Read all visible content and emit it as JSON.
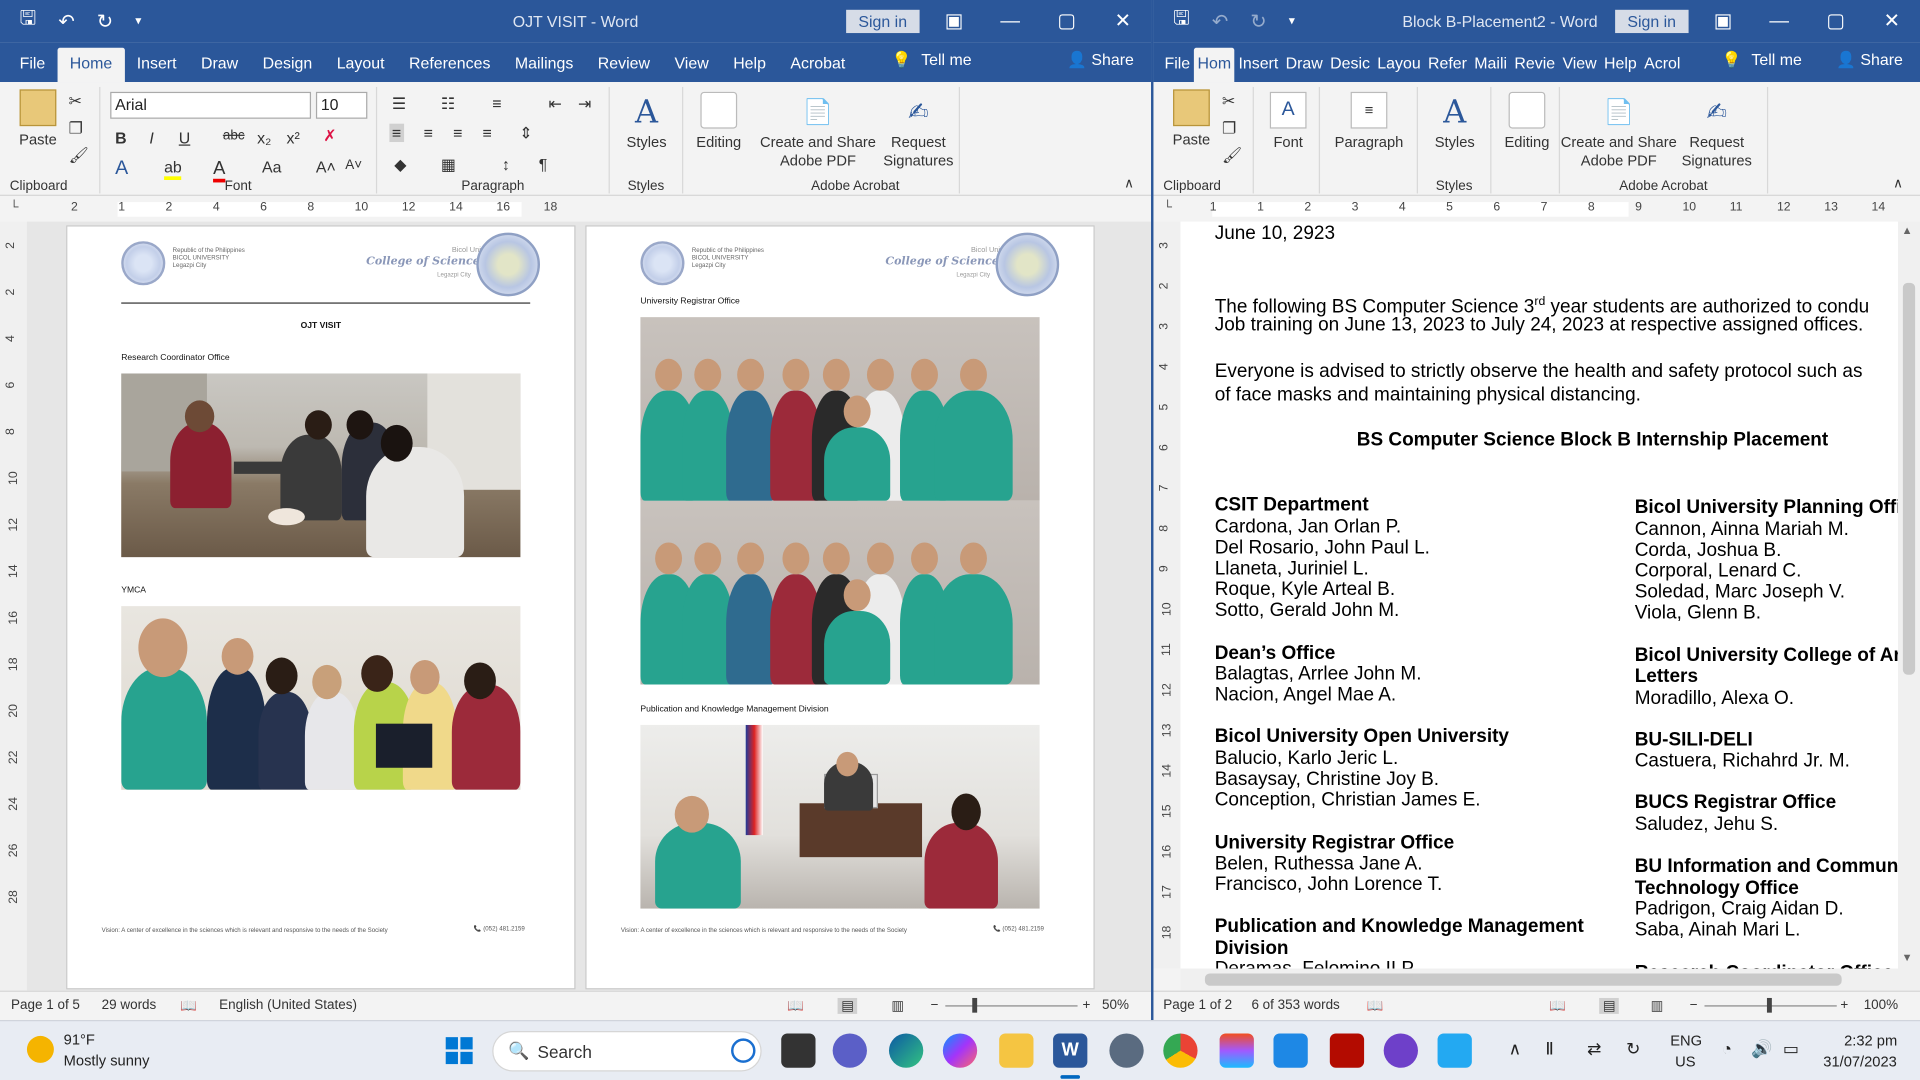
{
  "left_window": {
    "title": "OJT VISIT  -  Word",
    "signin": "Sign in",
    "tabs": [
      "File",
      "Home",
      "Insert",
      "Draw",
      "Design",
      "Layout",
      "References",
      "Mailings",
      "Review",
      "View",
      "Help",
      "Acrobat"
    ],
    "active_tab": "Home",
    "tell_me": "Tell me",
    "share": "Share",
    "font_name": "Arial",
    "font_size": "10",
    "groups": {
      "clipboard": "Clipboard",
      "font": "Font",
      "paragraph": "Paragraph",
      "styles": "Styles",
      "adobe": "Adobe Acrobat"
    },
    "buttons": {
      "paste": "Paste",
      "styles": "Styles",
      "editing": "Editing",
      "create_share_1": "Create and Share",
      "create_share_2": "Adobe PDF",
      "request_1": "Request",
      "request_2": "Signatures"
    },
    "ruler": [
      "2",
      "1",
      "2",
      "4",
      "6",
      "8",
      "10",
      "12",
      "14",
      "16",
      "18"
    ],
    "vruler": [
      "2",
      "2",
      "4",
      "6",
      "8",
      "10",
      "12",
      "14",
      "16",
      "18",
      "20",
      "22",
      "24",
      "26",
      "28"
    ],
    "page1": {
      "republic": "Republic of the Philippines",
      "university": "BICOL UNIVERSITY",
      "city": "Legazpi City",
      "bu": "Bicol University",
      "college": "College of Science",
      "college_city": "Legazpi City",
      "doc_title": "OJT VISIT",
      "caption1": "Research Coordinator Office",
      "caption2": "YMCA",
      "vision": "Vision: A center of excellence in the sciences which is relevant and responsive to the needs of the Society",
      "phone": "(052) 481.2159"
    },
    "page2": {
      "caption1": "University Registrar Office",
      "caption2": "Publication and Knowledge Management Division"
    },
    "status": {
      "page": "Page 1 of 5",
      "words": "29 words",
      "language": "English (United States)",
      "zoom": "50%"
    }
  },
  "right_window": {
    "title": "Block B-Placement2  -  Word",
    "signin": "Sign in",
    "tabs": [
      "File",
      "Hom",
      "Insert",
      "Draw",
      "Desic",
      "Layou",
      "Refer",
      "Maili",
      "Revie",
      "View",
      "Help",
      "Acrol"
    ],
    "active_tab": "Hom",
    "tell_me": "Tell me",
    "share": "Share",
    "groups": {
      "clipboard": "Clipboard",
      "styles": "Styles",
      "adobe": "Adobe Acrobat"
    },
    "buttons": {
      "paste": "Paste",
      "font": "Font",
      "paragraph": "Paragraph",
      "styles": "Styles",
      "editing": "Editing",
      "create_share_1": "Create and Share",
      "create_share_2": "Adobe PDF",
      "request_1": "Request",
      "request_2": "Signatures"
    },
    "ruler": [
      "1",
      "1",
      "2",
      "3",
      "4",
      "5",
      "6",
      "7",
      "8",
      "9",
      "10",
      "11",
      "12",
      "13",
      "14"
    ],
    "vruler": [
      "3",
      "2",
      "3",
      "4",
      "5",
      "6",
      "7",
      "8",
      "9",
      "10",
      "11",
      "12",
      "13",
      "14",
      "15",
      "16",
      "17",
      "18"
    ],
    "doc": {
      "date": "June 10, 2923",
      "para1_a": "The following BS Computer Science 3",
      "para1_sup": "rd",
      "para1_b": " year students are authorized to condu",
      "para1_line2": "Job training on June 13, 2023 to July 24, 2023 at respective assigned offices.",
      "para2_line1": "Everyone is advised to strictly observe the health and safety protocol such as",
      "para2_line2": "of face masks and maintaining physical distancing.",
      "heading": "BS Computer Science Block B Internship Placement",
      "left_col": [
        {
          "office": [
            "CSIT Department"
          ],
          "names": [
            "Cardona, Jan Orlan P.",
            "Del Rosario, John Paul L.",
            "Llaneta, Juriniel L.",
            "Roque, Kyle Arteal B.",
            "Sotto, Gerald John M."
          ]
        },
        {
          "office": [
            "Dean’s Office"
          ],
          "names": [
            "Balagtas, Arrlee John M.",
            "Nacion, Angel Mae A."
          ]
        },
        {
          "office": [
            "Bicol University Open University"
          ],
          "names": [
            "Balucio, Karlo Jeric L.",
            "Basaysay, Christine Joy B.",
            "Conception, Christian James E."
          ]
        },
        {
          "office": [
            "University Registrar Office"
          ],
          "names": [
            "Belen, Ruthessa Jane A.",
            "Francisco, John Lorence T."
          ]
        },
        {
          "office": [
            "Publication and Knowledge Management",
            "Division"
          ],
          "names": [
            "Deramas, Felomino II P."
          ]
        }
      ],
      "right_col": [
        {
          "office": [
            "Bicol University Planning Offic"
          ],
          "names": [
            "Cannon, Ainna Mariah M.",
            "Corda, Joshua B.",
            "Corporal, Lenard C.",
            "Soledad, Marc Joseph V.",
            "Viola, Glenn B."
          ]
        },
        {
          "office": [
            "Bicol University College of Art",
            "Letters"
          ],
          "names": [
            "Moradillo, Alexa O."
          ]
        },
        {
          "office": [
            "BU-SILI-DELI"
          ],
          "names": [
            "Castuera, Richahrd Jr. M."
          ]
        },
        {
          "office": [
            "BUCS Registrar Office"
          ],
          "names": [
            "Saludez, Jehu S."
          ]
        },
        {
          "office": [
            "BU Information and Communi",
            "Technology Office"
          ],
          "names": [
            "Padrigon, Craig Aidan D.",
            "Saba, Ainah Mari L."
          ]
        },
        {
          "office": [
            "Research Coordinator Office"
          ],
          "names": []
        }
      ]
    },
    "status": {
      "page": "Page 1 of 2",
      "words": "6 of 353 words",
      "zoom": "100%"
    }
  },
  "taskbar": {
    "weather_temp": "91°F",
    "weather_desc": "Mostly sunny",
    "search": "Search",
    "lang1": "ENG",
    "lang2": "US",
    "time": "2:32 pm",
    "date": "31/07/2023"
  },
  "colors": {
    "word_blue": "#2b579a",
    "taskbar": "#e8ecf3"
  }
}
